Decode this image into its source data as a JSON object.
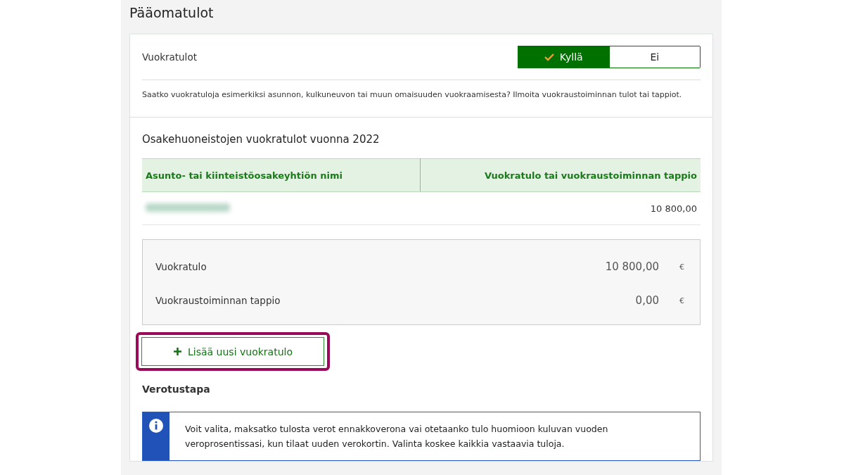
{
  "page_title": "Pääomatulot",
  "rental_question": {
    "label": "Vuokratulot",
    "options": [
      {
        "label": "Kyllä",
        "selected": true
      },
      {
        "label": "Ei",
        "selected": false
      }
    ],
    "description": "Saatko vuokratuloja esimerkiksi asunnon, kulkuneuvon tai muun omaisuuden vuokraamisesta? Ilmoita vuokraustoiminnan tulot tai tappiot."
  },
  "rental_table": {
    "title": "Osakehuoneistojen vuokratulot vuonna 2022",
    "columns": [
      "Asunto- tai kiinteistöosakeyhtiön nimi",
      "Vuokratulo tai vuokraustoiminnan tappio"
    ],
    "rows": [
      {
        "name_blurred": true,
        "amount": "10 800,00"
      }
    ]
  },
  "summary": [
    {
      "label": "Vuokratulo",
      "value": "10 800,00",
      "unit": "€"
    },
    {
      "label": "Vuokraustoiminnan tappio",
      "value": "0,00",
      "unit": "€"
    }
  ],
  "add_button": {
    "label": "Lisää uusi vuokratulo",
    "highlighted": true
  },
  "tax_method": {
    "title": "Verotustapa",
    "info": "Voit valita, maksatko tulosta verot ennakkoverona vai otetaanko tulo huomioon kuluvan vuoden veroprosentissasi, kun tilaat uuden verokortin. Valinta koskee kaikkia vastaavia tuloja."
  }
}
